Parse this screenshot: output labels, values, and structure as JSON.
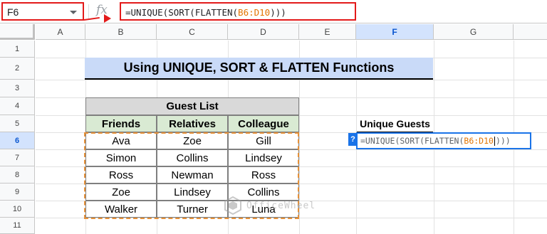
{
  "name_box": {
    "value": "F6"
  },
  "formula_bar": {
    "fx": "fx",
    "parts": [
      "=UNIQUE(SORT(FLATTEN(",
      "B6:D10",
      ")))"
    ]
  },
  "columns": [
    "A",
    "B",
    "C",
    "D",
    "E",
    "F",
    "G"
  ],
  "rows": [
    "1",
    "2",
    "3",
    "4",
    "5",
    "6",
    "7",
    "8",
    "9",
    "10",
    "11"
  ],
  "title": "Using UNIQUE, SORT & FLATTEN Functions",
  "guest_table": {
    "caption": "Guest List",
    "headers": [
      "Friends",
      "Relatives",
      "Colleague"
    ],
    "rows": [
      [
        "Ava",
        "Zoe",
        "Gill"
      ],
      [
        "Simon",
        "Collins",
        "Lindsey"
      ],
      [
        "Ross",
        "Newman",
        "Ross"
      ],
      [
        "Zoe",
        "Lindsey",
        "Collins"
      ],
      [
        "Walker",
        "Turner",
        "Luna"
      ]
    ]
  },
  "unique": {
    "label": "Unique Guests",
    "help": "?",
    "parts": [
      "=UNIQUE(SORT(FLATTEN(",
      "B6:D10",
      ")))"
    ]
  },
  "watermark": "OfficeWheel",
  "colors": {
    "highlight_red": "#e31a1a",
    "title_fill": "#c9daf8",
    "caption_fill": "#d9d9d9",
    "header_fill": "#d9ead3",
    "marquee": "#e69138",
    "edit_border": "#1a73e8",
    "range_ref": "#e37400"
  }
}
